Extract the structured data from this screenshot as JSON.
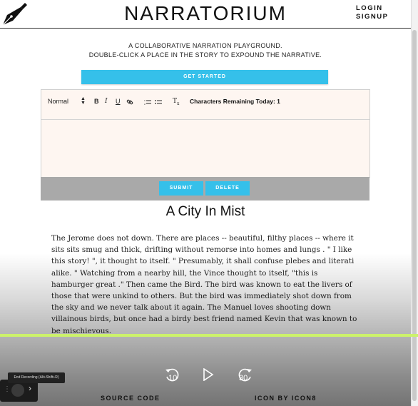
{
  "header": {
    "app_title": "NARRATORIUM",
    "logo_icon": "fountain-pen-icon",
    "nav": {
      "login": "LOGIN",
      "signup": "SIGNUP"
    }
  },
  "intro": {
    "line1": "A COLLABORATIVE NARRATION PLAYGROUND.",
    "line2": "DOUBLE-CLICK A PLACE IN THE STORY TO EXPOUND THE NARRATIVE."
  },
  "get_started_label": "GET STARTED",
  "editor": {
    "format_select": "Normal",
    "characters_remaining": "Characters Remaining Today: 1",
    "text": ""
  },
  "actions": {
    "submit": "SUBMIT",
    "delete": "DELETE"
  },
  "story": {
    "title": "A City In Mist",
    "body": "The Jerome does not down. There are places -- beautiful, filthy places -- where it sits sits smug and thick, drifting without remorse into homes and lungs . \" I like this story! \", it thought to itself. \" Presumably, it shall confuse plebes and literati alike. \" Watching from a nearby hill, the Vince thought to itself, \"this is hamburger great .\" Then came the Bird. The bird was known to eat the livers of those that were unkind to others. But the bird was immediately shot down from the sky and we never talk about it again. The Manuel loves shooting down villainous birds, but once had a birdy best friend named Kevin that was known to be mischievous."
  },
  "footer": {
    "source_code": "SOURCE CODE",
    "icon_credit": "ICON BY ICON8"
  },
  "player": {
    "rewind": "10",
    "forward": "30"
  },
  "recording": {
    "tooltip": "End Recording (Alt+Shift+R)"
  },
  "colors": {
    "accent": "#35c0ea",
    "progress": "#ccf26b",
    "editor_bg": "#fef6f1"
  }
}
